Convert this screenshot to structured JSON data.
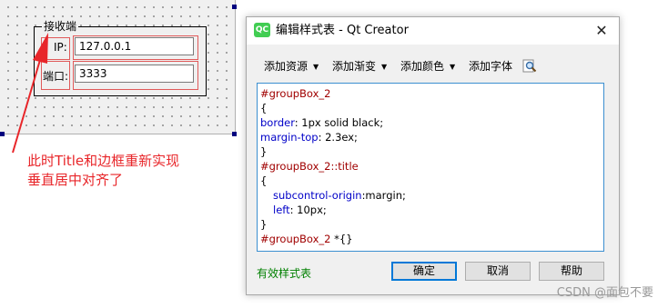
{
  "form": {
    "groupbox_title": "接收端",
    "ip_label": "IP:",
    "ip_value": "127.0.0.1",
    "port_label": "端口:",
    "port_value": "3333"
  },
  "annotation": {
    "text": "此时Title和边框重新实现\n垂直居中对齐了",
    "color": "#e8262a"
  },
  "dialog": {
    "title": "编辑样式表 - Qt Creator",
    "app_icon": "qt-logo-icon",
    "app_icon_text": "QC",
    "toolbar": [
      {
        "label": "添加资源"
      },
      {
        "label": "添加渐变"
      },
      {
        "label": "添加颜色"
      },
      {
        "label": "添加字体"
      }
    ],
    "editor_lines": [
      {
        "kind": "selector",
        "text": "#groupBox_2"
      },
      {
        "kind": "plain",
        "text": "{"
      },
      {
        "kind": "prop",
        "prop": "border",
        "value": ": 1px solid black;"
      },
      {
        "kind": "prop",
        "prop": "margin-top",
        "value": ": 2.3ex;"
      },
      {
        "kind": "plain",
        "text": "}"
      },
      {
        "kind": "selector",
        "text": "#groupBox_2::title"
      },
      {
        "kind": "plain",
        "text": "{"
      },
      {
        "kind": "prop-indent",
        "prop": "subcontrol-origin",
        "value": ":margin;"
      },
      {
        "kind": "prop-indent",
        "prop": "left",
        "value": ": 10px;"
      },
      {
        "kind": "plain",
        "text": "}"
      },
      {
        "kind": "selector-tail",
        "text": "#groupBox_2",
        "tail": " *{}"
      }
    ],
    "status": "有效样式表",
    "buttons": {
      "ok": "确定",
      "cancel": "取消",
      "help": "帮助"
    }
  },
  "watermark": "CSDN @面包不要"
}
